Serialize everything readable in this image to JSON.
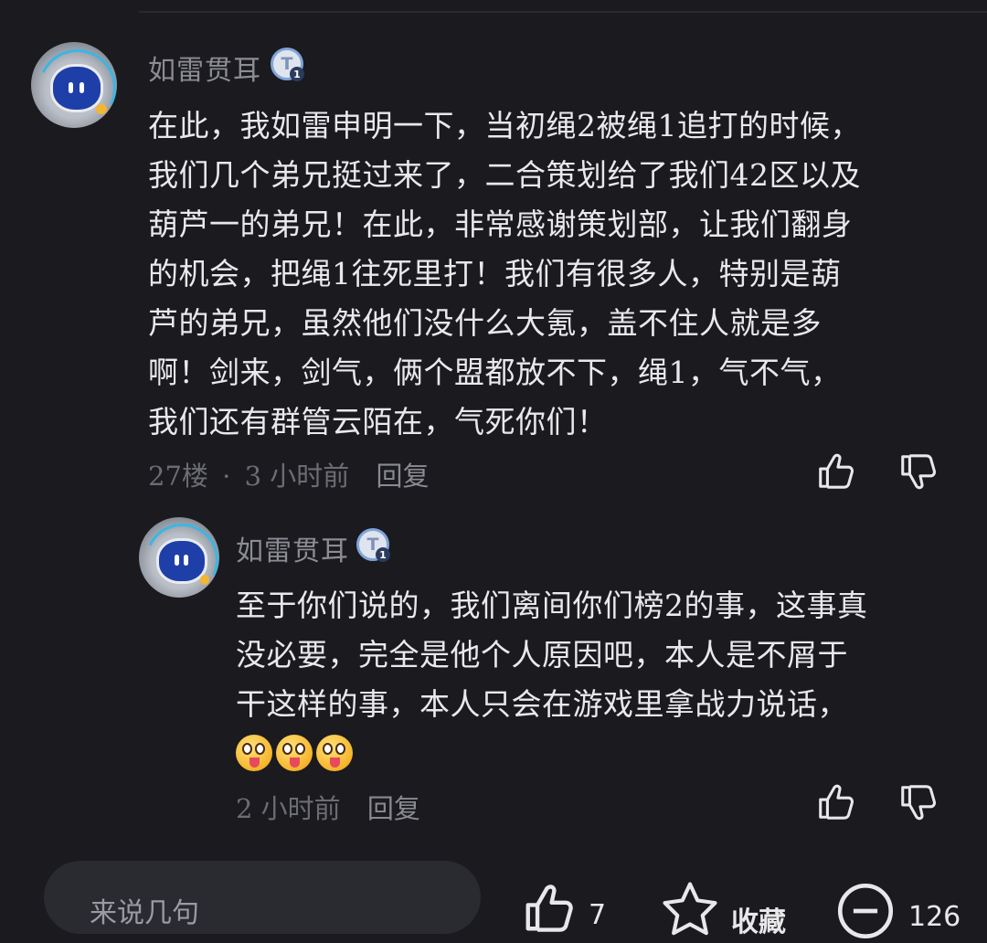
{
  "comments": [
    {
      "username": "如雷贯耳",
      "badge": "T",
      "badge_sub": "1",
      "text": "在此，我如雷申明一下，当初绳2被绳1追打的时候，\n我们几个弟兄挺过来了，二合策划给了我们42区以及\n葫芦一的弟兄！在此，非常感谢策划部，让我们翻身\n的机会，把绳1往死里打！我们有很多人，特别是葫\n芦的弟兄，虽然他们没什么大氪，盖不住人就是多\n啊！剑来，剑气，俩个盟都放不下，绳1，气不气，\n我们还有群管云陌在，气死你们！",
      "floor": "27楼",
      "separator": "·",
      "time": "3 小时前",
      "reply_label": "回复"
    },
    {
      "username": "如雷贯耳",
      "badge": "T",
      "badge_sub": "1",
      "text": "至于你们说的，我们离间你们榜2的事，这事真\n没必要，完全是他个人原因吧，本人是不屑于\n干这样的事，本人只会在游戏里拿战力说话，",
      "emoji_count": 3,
      "time": "2 小时前",
      "reply_label": "回复"
    }
  ],
  "bottom_bar": {
    "input_placeholder": "来说几句",
    "like_count": "7",
    "favorite_label": "收藏",
    "comment_count": "126"
  },
  "colors": {
    "background": "#1a1a1f",
    "text": "#e9e9ec",
    "muted": "#6c6c74",
    "avatar_ring": "#3cb6e3",
    "avatar_face": "#1f3fa8"
  }
}
